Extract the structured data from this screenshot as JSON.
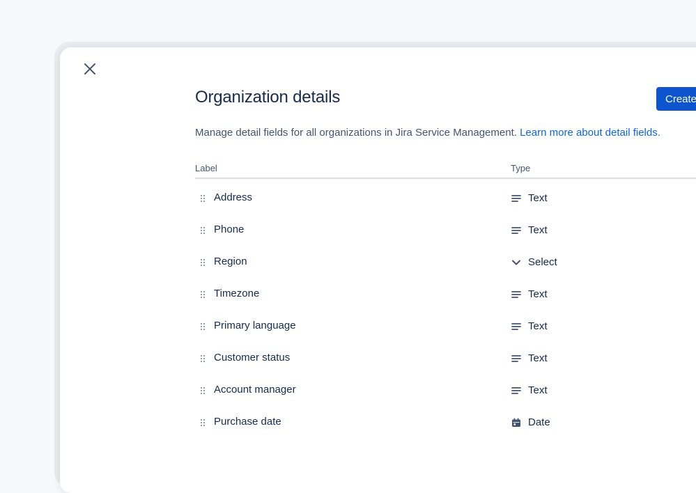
{
  "dialog": {
    "title": "Organization details",
    "create_button_label": "Create",
    "description": "Manage detail fields for all organizations in Jira Service Management.",
    "learn_more_link": "Learn more about detail fields.",
    "close_icon": "close-icon"
  },
  "table": {
    "headers": {
      "label": "Label",
      "type": "Type"
    },
    "rows": [
      {
        "label": "Address",
        "type": "Text",
        "icon": "text-lines-icon"
      },
      {
        "label": "Phone",
        "type": "Text",
        "icon": "text-lines-icon"
      },
      {
        "label": "Region",
        "type": "Select",
        "icon": "chevron-down-icon"
      },
      {
        "label": "Timezone",
        "type": "Text",
        "icon": "text-lines-icon"
      },
      {
        "label": "Primary language",
        "type": "Text",
        "icon": "text-lines-icon"
      },
      {
        "label": "Customer status",
        "type": "Text",
        "icon": "text-lines-icon"
      },
      {
        "label": "Account manager",
        "type": "Text",
        "icon": "text-lines-icon"
      },
      {
        "label": "Purchase date",
        "type": "Date",
        "icon": "calendar-icon"
      }
    ]
  },
  "colors": {
    "primary_button": "#0c55cf",
    "link": "#0c66e4",
    "text": "#172b4d",
    "subtle_text": "#44546f"
  }
}
